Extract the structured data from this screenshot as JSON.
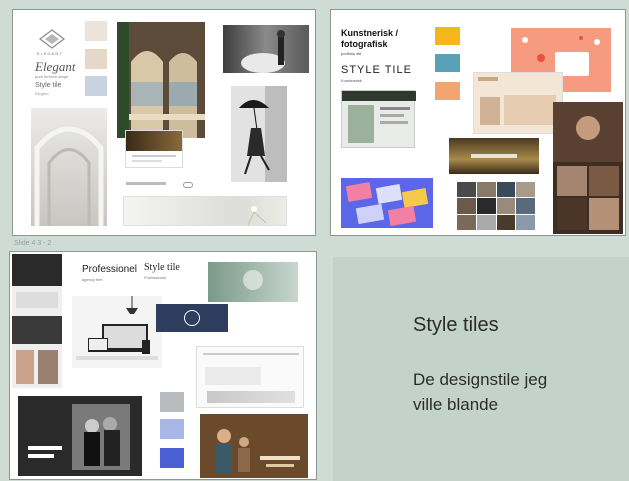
{
  "slides": {
    "s1": {
      "logo_text": "ELEGANT",
      "title": "Elegant",
      "subtitle": "pure feminin sørge",
      "style": "Style tile",
      "style_sub": "Elegant"
    },
    "s2": {
      "title_line1": "Kunstnerisk /",
      "title_line2": "fotografisk",
      "title_sub": "portfolio stil",
      "style_tile": "STYLE TILE",
      "style_sub": "Kunstnerisk"
    },
    "s3": {
      "label": "Slide 4 3 - 2",
      "professional": "Professionel",
      "professional_sub": "agency feel",
      "style_tile": "Style tile",
      "style_sub": "Professionel"
    },
    "s4": {
      "title": "Style tiles",
      "body_line1": "De designstile jeg",
      "body_line2": "ville blande"
    }
  },
  "colors": {
    "bg": "#cfdcd6",
    "slide4": "#c3d3ca",
    "text": "#2b2b2b",
    "s1_swatches": [
      "#ebe3db",
      "#e6d8c8",
      "#c8d2e0"
    ],
    "s2_swatches": [
      "#f5b81c",
      "#5aa0b6",
      "#f4a46e"
    ],
    "s3_swatches": [
      "#b9bcbf",
      "#a8b6e8",
      "#4a5fd4"
    ]
  }
}
